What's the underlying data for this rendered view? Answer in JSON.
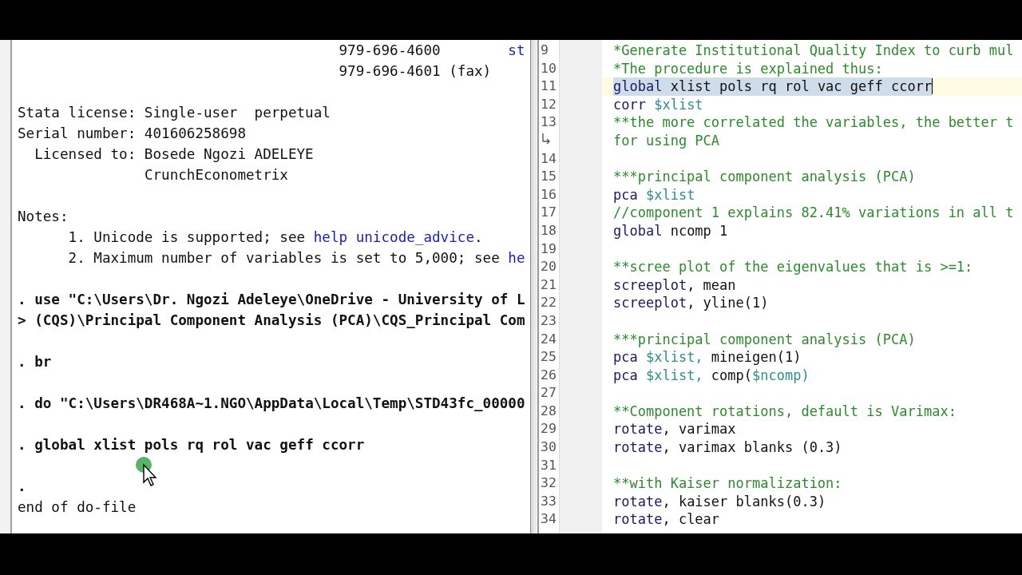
{
  "results": {
    "lines": [
      {
        "kind": "contact",
        "segments": [
          {
            "text": "979-696-4600"
          },
          {
            "text": "st",
            "link": true
          }
        ]
      },
      {
        "kind": "contact",
        "segments": [
          {
            "text": "979-696-4601 (fax)"
          }
        ]
      },
      {
        "kind": "blank"
      },
      {
        "kind": "field",
        "label": "Stata license:",
        "value": "Single-user  perpetual"
      },
      {
        "kind": "field",
        "label": "Serial number:",
        "value": "401606258698"
      },
      {
        "kind": "field",
        "label": "Licensed to:",
        "value": "Bosede Ngozi ADELEYE"
      },
      {
        "kind": "field",
        "value": "CrunchEconometrix"
      },
      {
        "kind": "blank"
      },
      {
        "kind": "plain",
        "segments": [
          {
            "text": "Notes:"
          }
        ]
      },
      {
        "kind": "note",
        "number": "1.",
        "segments": [
          {
            "text": "Unicode is supported; see "
          },
          {
            "text": "help unicode_advice",
            "link": true
          },
          {
            "text": "."
          }
        ]
      },
      {
        "kind": "note",
        "number": "2.",
        "segments": [
          {
            "text": "Maximum number of variables is set to 5,000; see "
          },
          {
            "text": "he",
            "link": true
          }
        ]
      },
      {
        "kind": "blank"
      },
      {
        "kind": "command",
        "prompt": ".",
        "segments": [
          {
            "text": "use \"C:\\Users\\Dr. Ngozi Adeleye\\OneDrive - University of L"
          }
        ]
      },
      {
        "kind": "command",
        "prompt": ">",
        "segments": [
          {
            "text": "(CQS)\\Principal Component Analysis (PCA)\\CQS_Principal Com"
          }
        ]
      },
      {
        "kind": "blank"
      },
      {
        "kind": "command",
        "prompt": ".",
        "segments": [
          {
            "text": "br"
          }
        ]
      },
      {
        "kind": "blank"
      },
      {
        "kind": "command",
        "prompt": ".",
        "segments": [
          {
            "text": "do \"C:\\Users\\DR468A~1.NGO\\AppData\\Local\\Temp\\STD43fc_00000"
          }
        ]
      },
      {
        "kind": "blank"
      },
      {
        "kind": "command",
        "prompt": ".",
        "segments": [
          {
            "text": "global xlist pols rq rol vac geff ccorr"
          }
        ]
      },
      {
        "kind": "blank"
      },
      {
        "kind": "command",
        "prompt": "."
      },
      {
        "kind": "plain",
        "segments": [
          {
            "text": "end of do-file"
          }
        ]
      }
    ]
  },
  "editor": {
    "lines": [
      {
        "number": "9",
        "current": false,
        "segments": [
          {
            "kind": "comment",
            "text": "*Generate Institutional Quality Index to curb mul"
          }
        ]
      },
      {
        "number": "10",
        "current": false,
        "segments": [
          {
            "kind": "comment",
            "text": "*The procedure is explained thus:"
          }
        ]
      },
      {
        "number": "11",
        "current": true,
        "segments": [
          {
            "kind": "keyword",
            "text": "global "
          },
          {
            "kind": "text",
            "text": "xlist pols rq rol vac geff ccorr"
          }
        ]
      },
      {
        "number": "12",
        "current": false,
        "segments": [
          {
            "kind": "keyword",
            "text": "corr "
          },
          {
            "kind": "macro",
            "text": "$xlist"
          }
        ]
      },
      {
        "number": "13",
        "current": false,
        "segments": [
          {
            "kind": "comment",
            "text": "**the more correlated the variables, the better t"
          }
        ],
        "wrap": [
          {
            "kind": "comment",
            "text": "for using PCA"
          }
        ]
      },
      {
        "number": "14",
        "current": false
      },
      {
        "number": "15",
        "current": false,
        "segments": [
          {
            "kind": "comment",
            "text": "***principal component analysis (PCA)"
          }
        ]
      },
      {
        "number": "16",
        "current": false,
        "segments": [
          {
            "kind": "keyword",
            "text": "pca "
          },
          {
            "kind": "macro",
            "text": "$xlist"
          }
        ]
      },
      {
        "number": "17",
        "current": false,
        "segments": [
          {
            "kind": "comment",
            "text": "//component 1 explains 82.41% variations in all t"
          }
        ]
      },
      {
        "number": "18",
        "current": false,
        "segments": [
          {
            "kind": "keyword",
            "text": "global "
          },
          {
            "kind": "text",
            "text": "ncomp 1"
          }
        ]
      },
      {
        "number": "19",
        "current": false
      },
      {
        "number": "20",
        "current": false,
        "segments": [
          {
            "kind": "comment",
            "text": "**scree plot of the eigenvalues that is >=1:"
          }
        ]
      },
      {
        "number": "21",
        "current": false,
        "segments": [
          {
            "kind": "keyword",
            "text": "screeplot"
          },
          {
            "kind": "text",
            "text": ", mean"
          }
        ]
      },
      {
        "number": "22",
        "current": false,
        "segments": [
          {
            "kind": "keyword",
            "text": "screeplot"
          },
          {
            "kind": "text",
            "text": ", yline(1)"
          }
        ]
      },
      {
        "number": "23",
        "current": false
      },
      {
        "number": "24",
        "current": false,
        "segments": [
          {
            "kind": "comment",
            "text": "***principal component analysis (PCA)"
          }
        ]
      },
      {
        "number": "25",
        "current": false,
        "segments": [
          {
            "kind": "keyword",
            "text": "pca "
          },
          {
            "kind": "macro",
            "text": "$xlist, "
          },
          {
            "kind": "text",
            "text": "mineigen(1)"
          }
        ]
      },
      {
        "number": "26",
        "current": false,
        "segments": [
          {
            "kind": "keyword",
            "text": "pca "
          },
          {
            "kind": "macro",
            "text": "$xlist, "
          },
          {
            "kind": "text",
            "text": "comp("
          },
          {
            "kind": "macro",
            "text": "$ncomp)"
          }
        ]
      },
      {
        "number": "27",
        "current": false
      },
      {
        "number": "28",
        "current": false,
        "segments": [
          {
            "kind": "comment",
            "text": "**Component rotations, default is Varimax:"
          }
        ]
      },
      {
        "number": "29",
        "current": false,
        "segments": [
          {
            "kind": "keyword",
            "text": "rotate"
          },
          {
            "kind": "text",
            "text": ", varimax"
          }
        ]
      },
      {
        "number": "30",
        "current": false,
        "segments": [
          {
            "kind": "keyword",
            "text": "rotate"
          },
          {
            "kind": "text",
            "text": ", varimax blanks (0.3)"
          }
        ]
      },
      {
        "number": "31",
        "current": false
      },
      {
        "number": "32",
        "current": false,
        "segments": [
          {
            "kind": "comment",
            "text": "**with Kaiser normalization:"
          }
        ]
      },
      {
        "number": "33",
        "current": false,
        "segments": [
          {
            "kind": "keyword",
            "text": "rotate"
          },
          {
            "kind": "text",
            "text": ", kaiser blanks(0.3)"
          }
        ]
      },
      {
        "number": "34",
        "current": false,
        "segments": [
          {
            "kind": "keyword",
            "text": "rotate"
          },
          {
            "kind": "text",
            "text": ", clear"
          }
        ]
      }
    ]
  }
}
